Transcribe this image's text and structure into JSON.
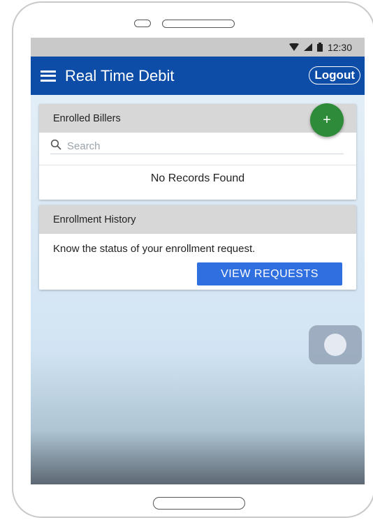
{
  "status_bar": {
    "time": "12:30",
    "icons": [
      "wifi-icon",
      "signal-icon",
      "battery-icon"
    ]
  },
  "app_bar": {
    "title": "Real Time Debit",
    "logout_label": "Logout",
    "color": "#0d4da8"
  },
  "enrolled_billers": {
    "header": "Enrolled Billers",
    "add_label": "+",
    "search_placeholder": "Search",
    "empty_text": "No Records Found"
  },
  "enrollment_history": {
    "header": "Enrollment History",
    "description": "Know the status of your enrollment request.",
    "view_button_label": "VIEW REQUESTS"
  },
  "colors": {
    "accent_button": "#2f6fe0",
    "fab": "#2d8b3a",
    "card_header": "#d7d7d7"
  }
}
